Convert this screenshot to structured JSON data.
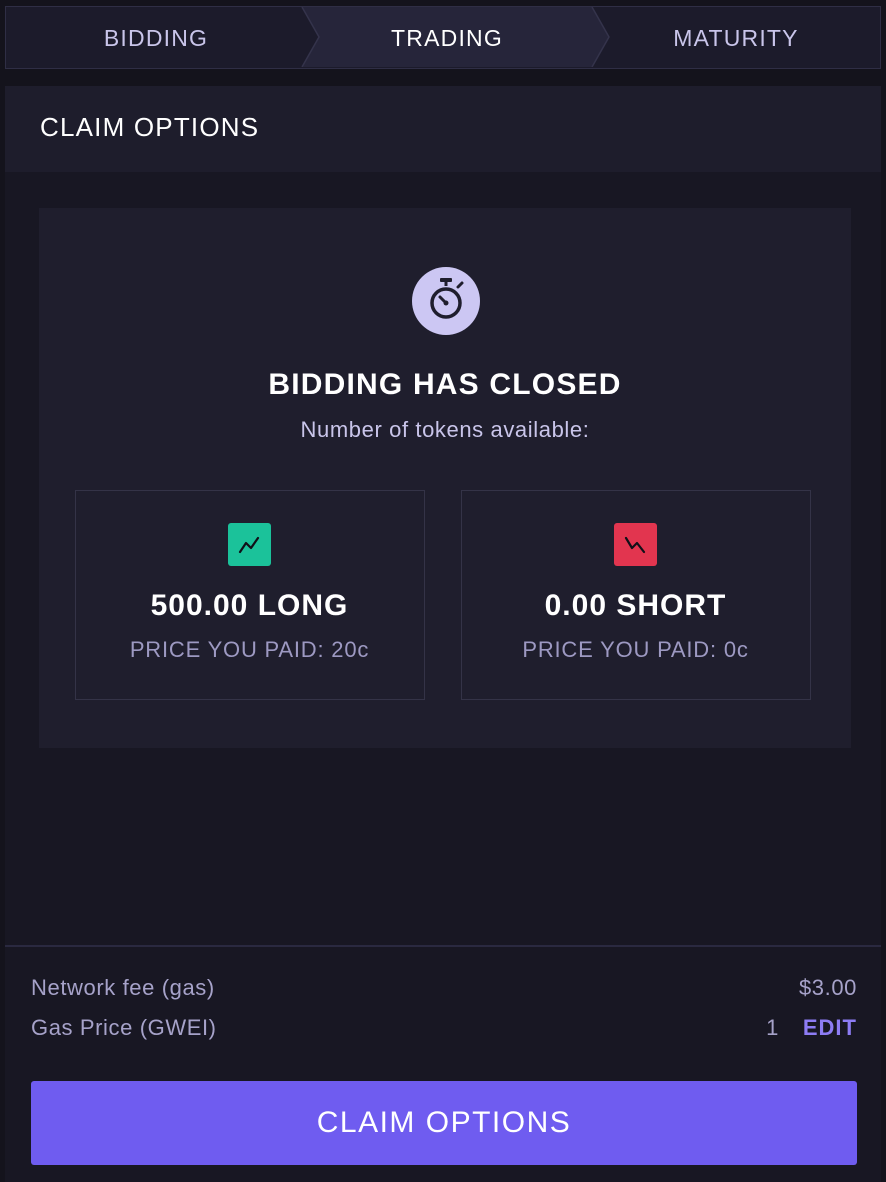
{
  "stepper": {
    "steps": [
      {
        "label": "BIDDING"
      },
      {
        "label": "TRADING"
      },
      {
        "label": "MATURITY"
      }
    ]
  },
  "panel": {
    "title": "CLAIM OPTIONS"
  },
  "status": {
    "icon": "stopwatch-icon",
    "title": "BIDDING HAS CLOSED",
    "subtitle": "Number of tokens available:"
  },
  "tokens": {
    "long": {
      "icon": "trend-up-icon",
      "amount": "500.00 LONG",
      "price_paid": "PRICE YOU PAID: 20c",
      "color": "#1bc29a"
    },
    "short": {
      "icon": "trend-down-icon",
      "amount": "0.00 SHORT",
      "price_paid": "PRICE YOU PAID: 0c",
      "color": "#e2354f"
    }
  },
  "fees": {
    "network_fee_label": "Network fee (gas)",
    "network_fee_value": "$3.00",
    "gas_price_label": "Gas Price (GWEI)",
    "gas_price_value": "1",
    "edit_label": "EDIT"
  },
  "action": {
    "button_label": "CLAIM OPTIONS",
    "color": "#6f5cf0"
  },
  "theme": {
    "background": "#14131c",
    "accent": "#6f5cf0"
  }
}
